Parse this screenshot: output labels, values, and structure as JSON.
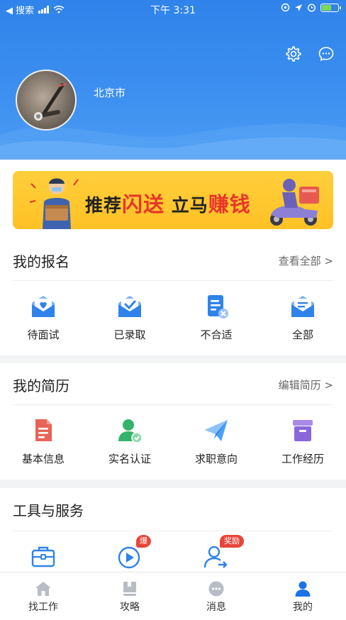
{
  "status_bar": {
    "back_label": "◀ 搜索",
    "time": "下午 3:31"
  },
  "profile": {
    "city": "北京市"
  },
  "banner": {
    "text_1": "推荐",
    "text_2": "闪送",
    "text_3": "立马",
    "text_4": "赚钱"
  },
  "applications": {
    "title": "我的报名",
    "link": "查看全部 >",
    "items": [
      {
        "label": "待面试",
        "icon": "envelope-heart-icon"
      },
      {
        "label": "已录取",
        "icon": "envelope-check-icon"
      },
      {
        "label": "不合适",
        "icon": "document-x-icon"
      },
      {
        "label": "全部",
        "icon": "envelope-list-icon"
      }
    ]
  },
  "resume": {
    "title": "我的简历",
    "link": "编辑简历 >",
    "items": [
      {
        "label": "基本信息",
        "icon": "profile-document-icon"
      },
      {
        "label": "实名认证",
        "icon": "verified-user-icon"
      },
      {
        "label": "求职意向",
        "icon": "paper-plane-icon"
      },
      {
        "label": "工作经历",
        "icon": "archive-box-icon"
      }
    ]
  },
  "tools": {
    "title": "工具与服务",
    "items": [
      {
        "icon": "briefcase-icon"
      },
      {
        "icon": "play-video-icon",
        "badge": "爆"
      },
      {
        "icon": "user-arrow-icon",
        "badge": "奖励"
      }
    ]
  },
  "tabbar": {
    "items": [
      {
        "label": "找工作",
        "icon": "home-icon",
        "active": false
      },
      {
        "label": "攻略",
        "icon": "book-icon",
        "active": false
      },
      {
        "label": "消息",
        "icon": "chat-icon",
        "active": false
      },
      {
        "label": "我的",
        "icon": "person-icon",
        "active": true
      }
    ]
  },
  "colors": {
    "primary": "#2f83ea",
    "accent_red": "#e8463a",
    "banner_yellow": "#ffc125",
    "active_tab": "#1a73e8"
  }
}
